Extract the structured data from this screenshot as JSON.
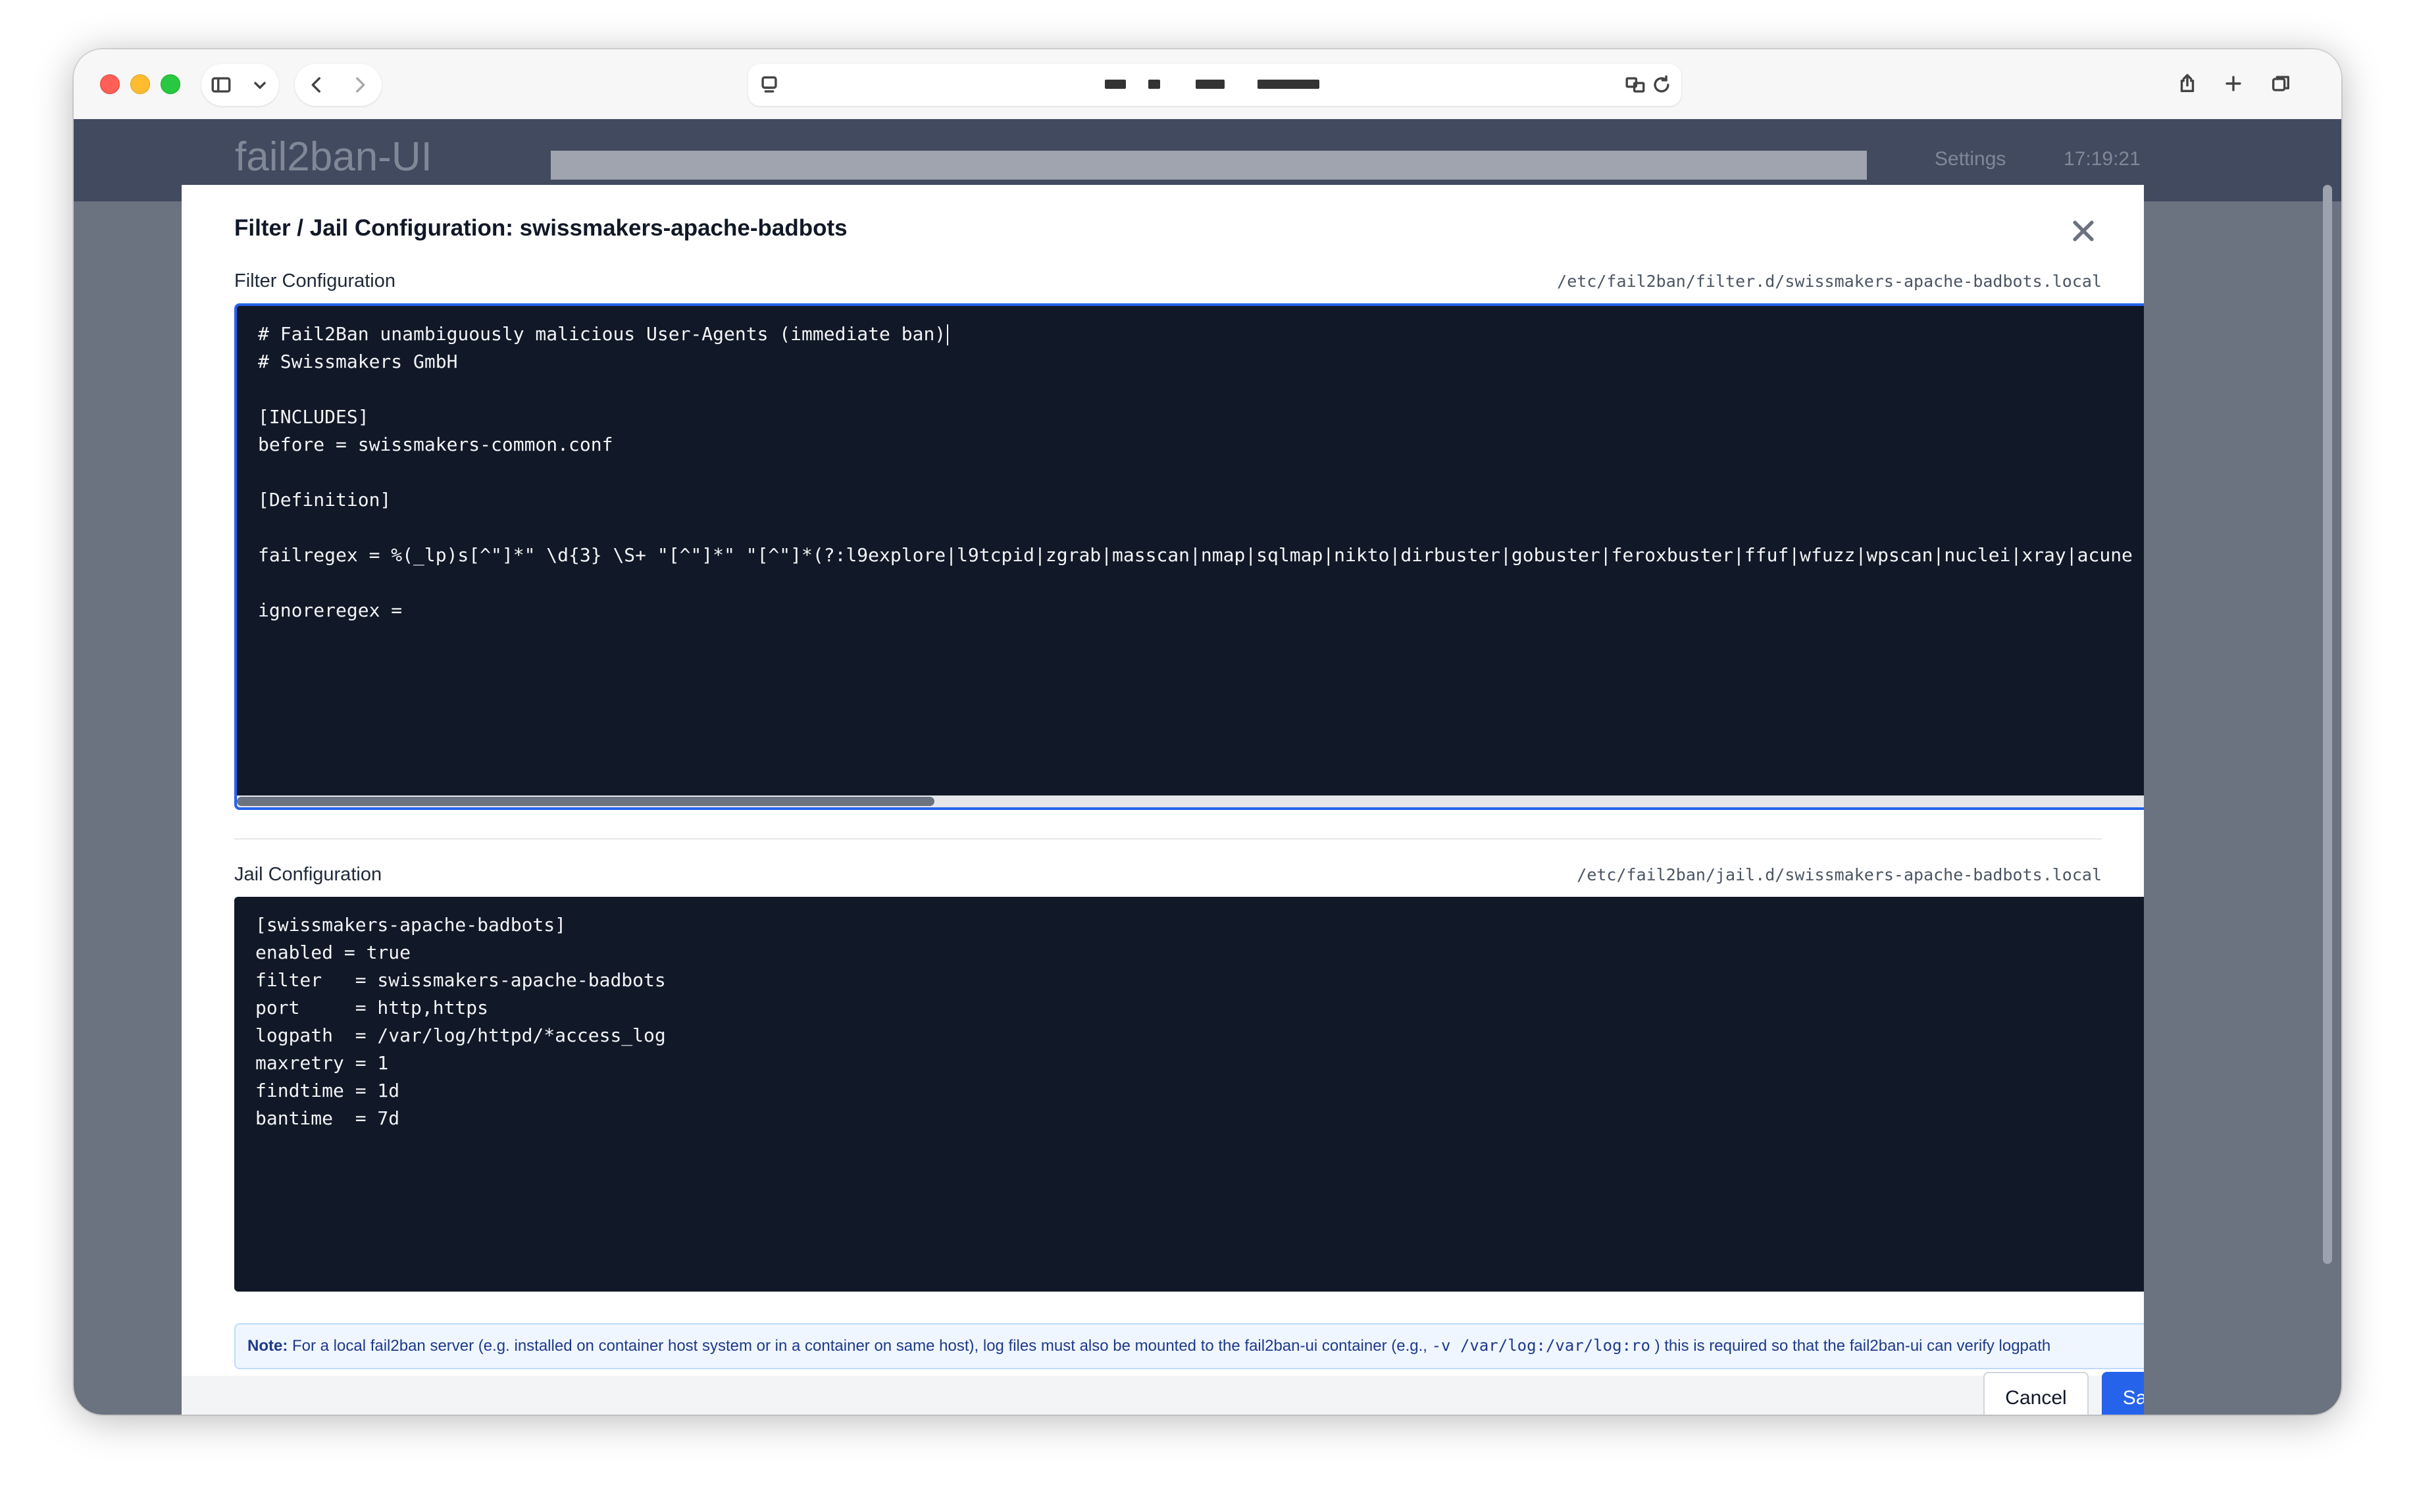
{
  "browser": {
    "nav_back": "back-chevron",
    "nav_forward": "forward-chevron",
    "actions": [
      "share-icon",
      "new-tab-icon",
      "tab-overview-icon"
    ]
  },
  "app": {
    "logo": "fail2ban-UI",
    "nav": [
      "Settings",
      "17:19:21"
    ]
  },
  "modal": {
    "title": "Filter / Jail Configuration: swissmakers-apache-badbots",
    "filter": {
      "label": "Filter Configuration",
      "path": "/etc/fail2ban/filter.d/swissmakers-apache-badbots.local",
      "lines": [
        "# Fail2Ban unambiguously malicious User-Agents (immediate ban)",
        "# Swissmakers GmbH",
        "",
        "[INCLUDES]",
        "before = swissmakers-common.conf",
        "",
        "[Definition]",
        "",
        "failregex = %(_lp)s[^\"]*\" \\d{3} \\S+ \"[^\"]*\" \"[^\"]*(?:l9explore|l9tcpid|zgrab|masscan|nmap|sqlmap|nikto|dirbuster|gobuster|feroxbuster|ffuf|wfuzz|wpscan|nuclei|xray|acune",
        "",
        "ignoreregex ="
      ]
    },
    "jail": {
      "label": "Jail Configuration",
      "path": "/etc/fail2ban/jail.d/swissmakers-apache-badbots.local",
      "lines": [
        "[swissmakers-apache-badbots]",
        "enabled = true",
        "filter   = swissmakers-apache-badbots",
        "port     = http,https",
        "logpath  = /var/log/httpd/*access_log",
        "maxretry = 1",
        "findtime = 1d",
        "bantime  = 7d"
      ]
    },
    "note": {
      "label": "Note:",
      "text_before": " For a local fail2ban server (e.g. installed on container host system or in a container on same host), log files must also be mounted to the fail2ban-ui container (e.g., ",
      "code": "-v /var/log:/var/log:ro",
      "text_after": " ) this is required so that the fail2ban-ui can verify logpath"
    },
    "cancel_label": "Cancel",
    "save_label": "Save"
  },
  "colors": {
    "accent": "#2563eb",
    "editor_bg": "#111827",
    "overlay": "#6b7280"
  }
}
